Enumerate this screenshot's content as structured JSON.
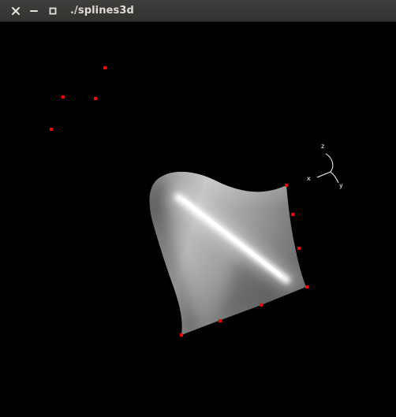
{
  "window": {
    "title": "./splines3d",
    "controls": {
      "close_icon": "close-icon",
      "minimize_icon": "minimize-icon",
      "maximize_icon": "maximize-icon"
    }
  },
  "viewport": {
    "background_color": "#000000",
    "control_point_color": "#ff0000",
    "surface_color": "#a8a8a8",
    "axis_labels": {
      "x": "x",
      "y": "y",
      "z": "z"
    }
  }
}
